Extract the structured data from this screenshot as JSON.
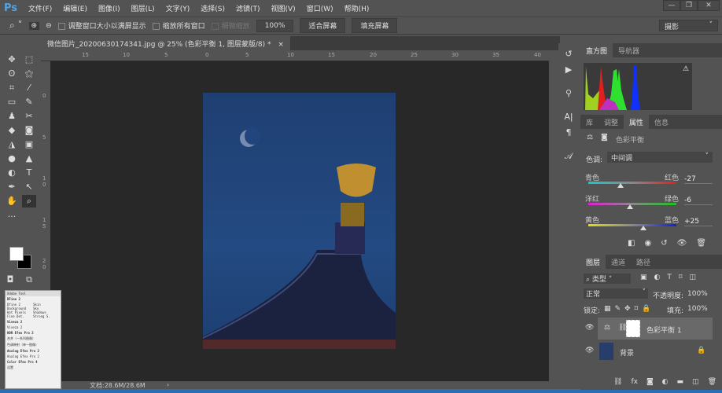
{
  "app": {
    "logo": "Ps"
  },
  "menu": [
    "文件(F)",
    "编辑(E)",
    "图像(I)",
    "图层(L)",
    "文字(Y)",
    "选择(S)",
    "滤镜(T)",
    "视图(V)",
    "窗口(W)",
    "帮助(H)"
  ],
  "window_controls": {
    "minimize": "—",
    "restore": "❐",
    "close": "✕"
  },
  "options": {
    "resize_windows": "调整窗口大小以满屏显示",
    "zoom_all": "缩放所有窗口",
    "scrubby": "细微缩放",
    "btn_100": "100%",
    "fit_screen": "适合屏幕",
    "fill_screen": "填充屏幕",
    "workspace": "摄影"
  },
  "document": {
    "tab_title": "微信图片_20200630174341.jpg @ 25% (色彩平衡 1, 图层蒙版/8) *",
    "close": "×",
    "status": "文档:28.6M/28.6M",
    "status_arrow": "›"
  },
  "ruler": {
    "h": [
      "15",
      "10",
      "5",
      "0",
      "5",
      "10",
      "15",
      "20",
      "25",
      "30",
      "35",
      "40"
    ],
    "v": [
      "0",
      "5",
      "1 0",
      "1 5",
      "2 0"
    ]
  },
  "histogram_panel": {
    "tabs": [
      "直方图",
      "导航器"
    ],
    "warning": "⚠"
  },
  "properties_panel": {
    "tabs": [
      "库",
      "调整",
      "属性",
      "信息"
    ],
    "active_tab": "属性",
    "title": "色彩平衡",
    "tone_label": "色调:",
    "tone_value": "中间调",
    "sliders": [
      {
        "left": "青色",
        "right": "红色",
        "value": "-27",
        "position": -27,
        "colors": [
          "#19c8c8",
          "#e02020"
        ]
      },
      {
        "left": "洋红",
        "right": "绿色",
        "value": "-6",
        "position": -6,
        "colors": [
          "#e020d0",
          "#20c020"
        ]
      },
      {
        "left": "黄色",
        "right": "蓝色",
        "value": "+25",
        "position": 25,
        "colors": [
          "#e0e010",
          "#1020e0"
        ]
      }
    ]
  },
  "layers_panel": {
    "tabs": [
      "图层",
      "通道",
      "路径"
    ],
    "filter": "类型",
    "blend_mode": "正常",
    "opacity_label": "不透明度:",
    "opacity": "100%",
    "lock_label": "锁定:",
    "fill_label": "填充:",
    "fill": "100%",
    "layers": [
      {
        "name": "色彩平衡 1",
        "selected": true
      },
      {
        "name": "背景",
        "locked": true
      }
    ]
  },
  "plugin_panel": {
    "title": "Adobe Tool",
    "sections": [
      {
        "name": "DFine 2",
        "items": [
          "Dfine 2",
          "Skin",
          "Background",
          "Sky",
          "Hot Pixels",
          "Shadows",
          "Fine Det.",
          "Strong S."
        ]
      },
      {
        "name": "Viveza 2",
        "items": [
          "Viveza 2"
        ]
      },
      {
        "name": "HDR Efex Pro 2",
        "items": [
          "合并（一系列图像）",
          "色调映射（单一图像）"
        ]
      },
      {
        "name": "Analog Efex Pro 2",
        "items": [
          "Analog Efex Pro 2"
        ]
      },
      {
        "name": "Color Efex Pro 4",
        "items": []
      }
    ],
    "footer": "设置"
  }
}
